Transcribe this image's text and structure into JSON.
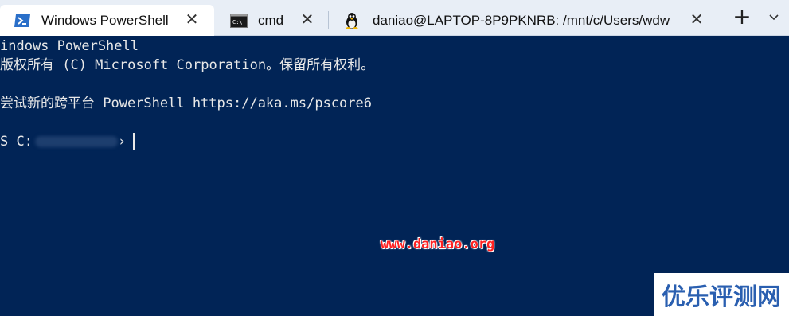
{
  "tabs": [
    {
      "label": "Windows PowerShell",
      "icon": "powershell-icon",
      "close": "✕",
      "active": true
    },
    {
      "label": "cmd",
      "icon": "cmd-icon",
      "close": "✕",
      "active": false
    },
    {
      "label": "daniao@LAPTOP-8P9PKNRB: /mnt/c/Users/wdw",
      "icon": "linux-penguin-icon",
      "close": "✕",
      "active": false
    }
  ],
  "new_tab": "+",
  "dropdown_icon": "chevron-down-icon",
  "terminal": {
    "lines": [
      "indows PowerShell",
      "版权所有 (C) Microsoft Corporation。保留所有权利。",
      "尝试新的跨平台 PowerShell https://aka.ms/pscore6",
      "S C:"
    ],
    "prompt_suffix": "›"
  },
  "watermark": {
    "url": "www.daniao.org",
    "logo": "优乐评测网"
  },
  "colors": {
    "terminal_bg": "#012456",
    "terminal_fg": "#e8e8e8",
    "tabbar_bg": "#e8eef6",
    "watermark_red": "#ff2222",
    "logo_blue": "#2a5fb0"
  }
}
